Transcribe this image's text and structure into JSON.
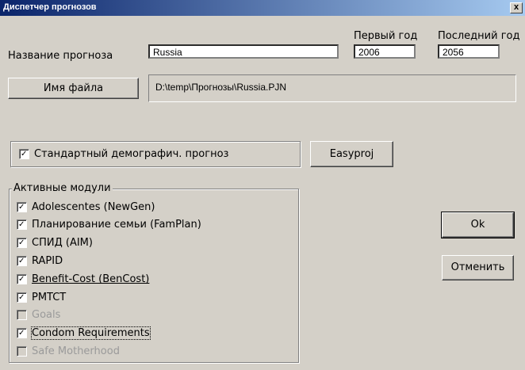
{
  "window": {
    "title": "Диспетчер прогнозов",
    "close_label": "x"
  },
  "projection_name": {
    "label": "Название прогноза",
    "value": "Russia"
  },
  "first_year": {
    "label": "Первый год",
    "value": "2006"
  },
  "last_year": {
    "label": "Последний год",
    "value": "2056"
  },
  "file": {
    "button_label": "Имя файла",
    "path": "D:\\temp\\Прогнозы\\Russia.PJN"
  },
  "standard_demography": {
    "label": "Стандартный демографич. прогноз",
    "checked": true
  },
  "easyproj_button": "Easyproj",
  "modules": {
    "title": "Активные модули",
    "items": [
      {
        "label": "Adolescentes (NewGen)",
        "checked": true,
        "enabled": true
      },
      {
        "label": "Планирование семьи (FamPlan)",
        "checked": true,
        "enabled": true
      },
      {
        "label": "СПИД (AIM)",
        "checked": true,
        "enabled": true
      },
      {
        "label": "RAPID",
        "checked": true,
        "enabled": true
      },
      {
        "label": "Benefit-Cost (BenCost)",
        "checked": true,
        "enabled": true
      },
      {
        "label": "PMTCT",
        "checked": true,
        "enabled": true
      },
      {
        "label": "Goals",
        "checked": false,
        "enabled": false
      },
      {
        "label": "Condom Requirements",
        "checked": true,
        "enabled": true
      },
      {
        "label": "Safe Motherhood",
        "checked": false,
        "enabled": false
      }
    ]
  },
  "ok_button": "Ok",
  "cancel_button": "Отменить"
}
